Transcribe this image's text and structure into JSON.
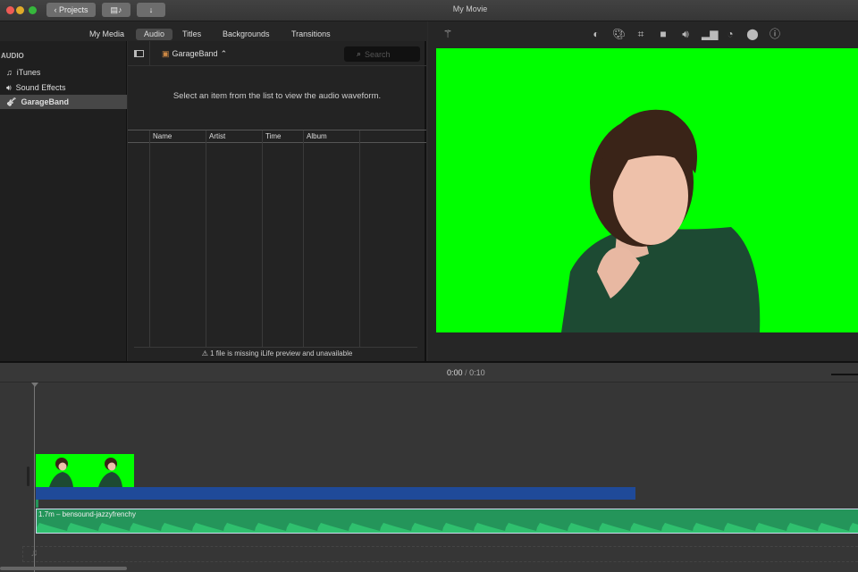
{
  "window": {
    "title": "My Movie",
    "projects_label": "Projects"
  },
  "tabs": [
    {
      "label": "My Media"
    },
    {
      "label": "Audio",
      "selected": true
    },
    {
      "label": "Titles"
    },
    {
      "label": "Backgrounds"
    },
    {
      "label": "Transitions"
    }
  ],
  "sidebar": {
    "header": "AUDIO",
    "items": [
      {
        "label": "iTunes",
        "icon": "music-note-icon"
      },
      {
        "label": "Sound Effects",
        "icon": "speaker-icon"
      },
      {
        "label": "GarageBand",
        "icon": "guitar-icon",
        "selected": true
      }
    ]
  },
  "browser": {
    "source": "GarageBand",
    "search_placeholder": "Search",
    "message": "Select an item from the list to view the audio waveform.",
    "columns": [
      "Name",
      "Artist",
      "Time",
      "Album"
    ],
    "footer": "1 file is missing iLife preview and unavailable"
  },
  "viewer": {
    "tools": [
      "magic-wand-icon",
      "color-balance-icon",
      "color-correction-icon",
      "crop-icon",
      "stabilization-icon",
      "volume-icon",
      "equalizer-icon",
      "speed-icon",
      "clip-filter-icon",
      "info-icon"
    ]
  },
  "timeline": {
    "current_time": "0:00",
    "separator": "/",
    "duration": "0:10",
    "audio_clip": "1.7m – bensound-jazzyfrenchy"
  },
  "colors": {
    "green_screen": "#00ff00",
    "audio_clip": "#24955a",
    "blue_bar": "#1f4a99"
  }
}
